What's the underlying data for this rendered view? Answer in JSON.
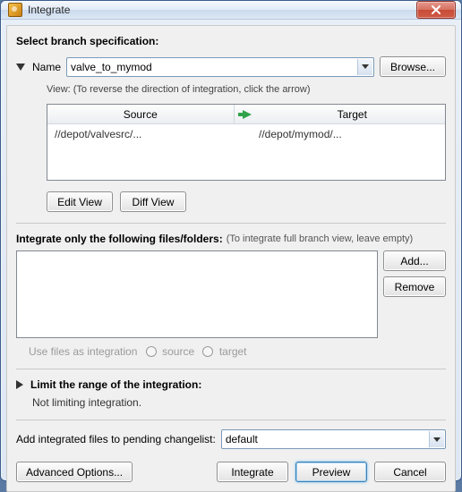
{
  "window": {
    "title": "Integrate"
  },
  "section1": {
    "title": "Select branch specification:",
    "name_label": "Name",
    "name_value": "valve_to_mymod",
    "browse": "Browse...",
    "view_hint": "View: (To reverse the direction of integration, click the arrow)",
    "col_source": "Source",
    "col_target": "Target",
    "row_source": "//depot/valvesrc/...",
    "row_target": "//depot/mymod/...",
    "edit_view": "Edit View",
    "diff_view": "Diff View"
  },
  "section2": {
    "title": "Integrate only the following files/folders:",
    "hint": "(To integrate full branch view, leave empty)",
    "add": "Add...",
    "remove": "Remove",
    "use_label": "Use files as integration",
    "opt_source": "source",
    "opt_target": "target"
  },
  "section3": {
    "title": "Limit the range of the integration:",
    "status": "Not limiting integration."
  },
  "changelist": {
    "label": "Add integrated files to pending changelist:",
    "value": "default"
  },
  "actions": {
    "advanced": "Advanced Options...",
    "integrate": "Integrate",
    "preview": "Preview",
    "cancel": "Cancel"
  }
}
